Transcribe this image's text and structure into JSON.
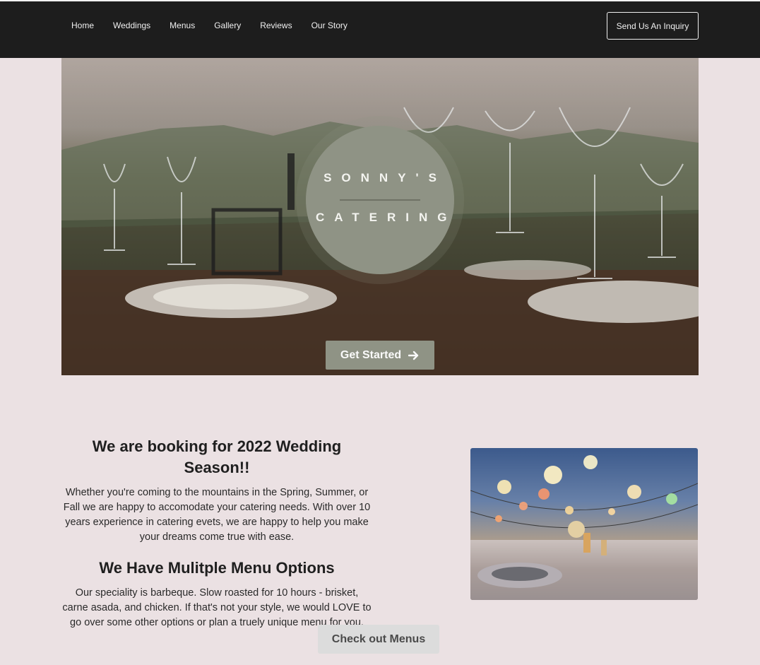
{
  "nav": {
    "items": [
      "Home",
      "Weddings",
      "Menus",
      "Gallery",
      "Reviews",
      "Our Story"
    ],
    "inquiry_label": "Send Us An Inquiry"
  },
  "hero": {
    "logo_line1": "SONNY'S",
    "logo_line2": "CATERING",
    "cta_label": "Get Started",
    "cta_icon": "arrow-right-icon"
  },
  "intro": {
    "heading": "We are booking for 2022 Wedding Season!!",
    "paragraph": "Whether you're coming to the mountains in the Spring, Summer, or Fall we are happy to accomodate your catering needs. With over 10 years experience in catering evets, we are happy to help you make your dreams come true with ease.",
    "menu_heading": "We Have Mulitple Menu Options",
    "menu_paragraph": "Our speciality is barbeque. Slow roasted for 10 hours - brisket, carne asada, and chicken. If that's not your style, we would LOVE to go over some other options or plan a truely unique menu for you.",
    "menus_button": "Check out Menus"
  },
  "colors": {
    "nav_bg": "#1d1d1d",
    "page_bg": "#ebe1e3",
    "accent": "#8f9385",
    "secondary_button": "#dcdcdc"
  }
}
